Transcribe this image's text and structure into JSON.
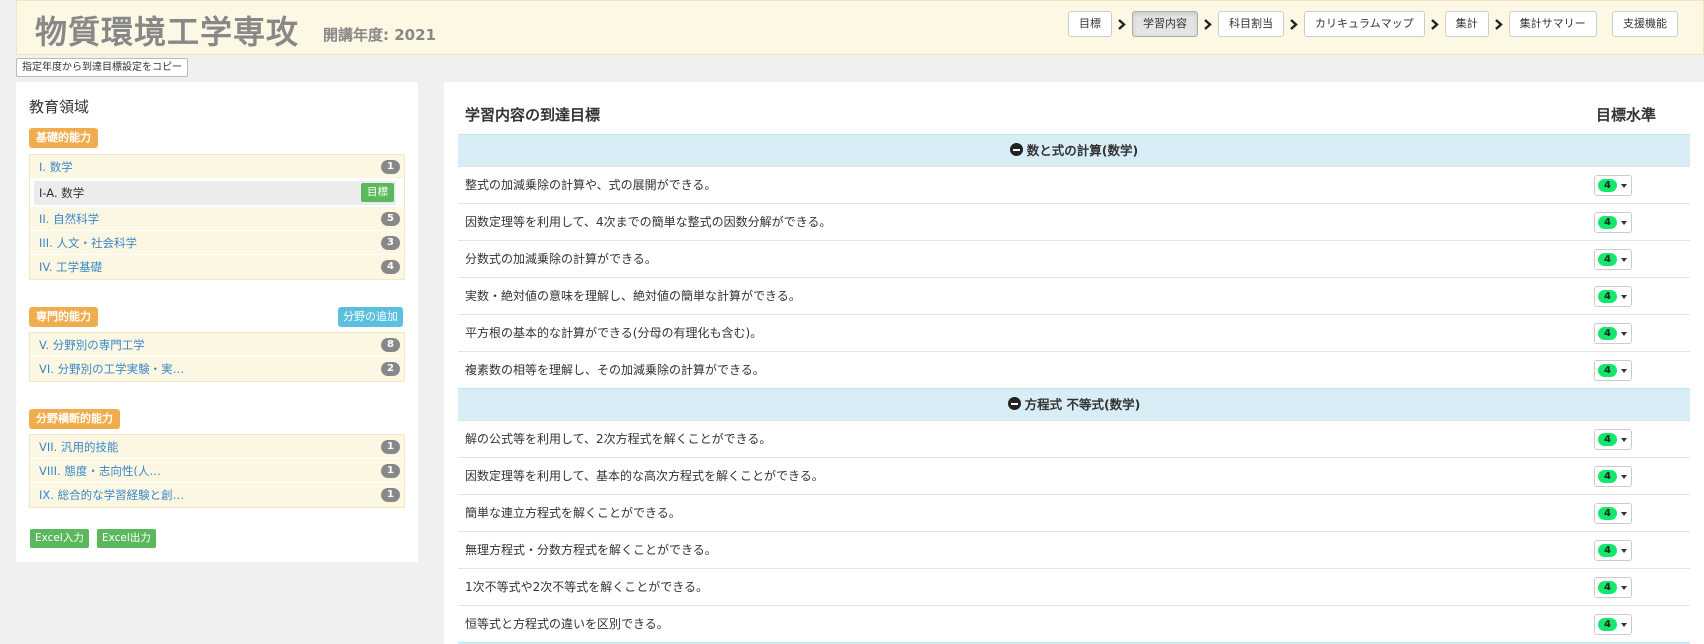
{
  "header": {
    "title": "物質環境工学専攻",
    "year_label": "開講年度: 2021",
    "nav": [
      {
        "label": "目標",
        "active": false
      },
      {
        "label": "学習内容",
        "active": true
      },
      {
        "label": "科目割当",
        "active": false
      },
      {
        "label": "カリキュラムマップ",
        "active": false
      },
      {
        "label": "集計",
        "active": false
      },
      {
        "label": "集計サマリー",
        "active": false
      }
    ],
    "support_label": "支援機能"
  },
  "copy_button_label": "指定年度から到達目標設定をコピー",
  "left_panel": {
    "title": "教育領域",
    "categories": [
      {
        "label": "基礎的能力",
        "items": [
          {
            "label": "I. 数学",
            "count": "1"
          },
          {
            "label": "I-A. 数学",
            "goal_label": "目標",
            "selected": true
          },
          {
            "label": "II. 自然科学",
            "count": "5"
          },
          {
            "label": "III. 人文・社会科学",
            "count": "3"
          },
          {
            "label": "IV. 工学基礎",
            "count": "4"
          }
        ]
      },
      {
        "label": "専門的能力",
        "add_label": "分野の追加",
        "items": [
          {
            "label": "V. 分野別の専門工学",
            "count": "8"
          },
          {
            "label": "VI. 分野別の工学実験・実…",
            "count": "2"
          }
        ]
      },
      {
        "label": "分野横断的能力",
        "items": [
          {
            "label": "VII. 汎用的技能",
            "count": "1"
          },
          {
            "label": "VIII. 態度・志向性(人…",
            "count": "1"
          },
          {
            "label": "IX. 総合的な学習経験と創…",
            "count": "1"
          }
        ]
      }
    ],
    "excel_in": "Excel入力",
    "excel_out": "Excel出力"
  },
  "main": {
    "title": "学習内容の到達目標",
    "level_header": "目標水準",
    "sections": [
      {
        "title": "数と式の計算(数学)",
        "rows": [
          {
            "text": "整式の加減乗除の計算や、式の展開ができる。",
            "level": "4"
          },
          {
            "text": "因数定理等を利用して、4次までの簡単な整式の因数分解ができる。",
            "level": "4"
          },
          {
            "text": "分数式の加減乗除の計算ができる。",
            "level": "4"
          },
          {
            "text": "実数・絶対値の意味を理解し、絶対値の簡単な計算ができる。",
            "level": "4"
          },
          {
            "text": "平方根の基本的な計算ができる(分母の有理化も含む)。",
            "level": "4"
          },
          {
            "text": "複素数の相等を理解し、その加減乗除の計算ができる。",
            "level": "4"
          }
        ]
      },
      {
        "title": "方程式 不等式(数学)",
        "rows": [
          {
            "text": "解の公式等を利用して、2次方程式を解くことができる。",
            "level": "4"
          },
          {
            "text": "因数定理等を利用して、基本的な高次方程式を解くことができる。",
            "level": "4"
          },
          {
            "text": "簡単な連立方程式を解くことができる。",
            "level": "4"
          },
          {
            "text": "無理方程式・分数方程式を解くことができる。",
            "level": "4"
          },
          {
            "text": "1次不等式や2次不等式を解くことができる。",
            "level": "4"
          },
          {
            "text": "恒等式と方程式の違いを区別できる。",
            "level": "4"
          }
        ]
      }
    ]
  },
  "colors": {
    "header_bg": "#fdf8e4",
    "category_orange": "#f0ad4e",
    "info_blue": "#5bc0de",
    "success_green": "#5cb85c",
    "level_green": "#14e76c",
    "section_bg": "#d9edf7"
  }
}
